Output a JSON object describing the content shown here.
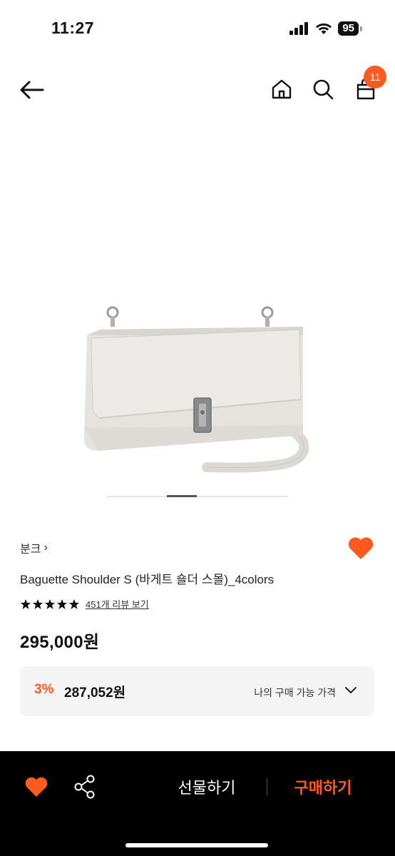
{
  "status_bar": {
    "time": "11:27",
    "battery": "95"
  },
  "header": {
    "cart_count": "11"
  },
  "product": {
    "brand": "분크",
    "brand_chevron": "›",
    "name": "Baguette Shoulder S (바게트 숄더 스몰)_4colors",
    "rating_stars": 5,
    "review_link": "451개 리뷰 보기",
    "price": "295,000원",
    "image_pages": {
      "current": 2,
      "total": 6
    }
  },
  "my_price": {
    "discount_rate": "3%",
    "discounted_price": "287,052원",
    "label": "나의 구매 가능 가격"
  },
  "bottom_bar": {
    "gift_label": "선물하기",
    "buy_label": "구매하기"
  },
  "colors": {
    "accent": "#ff5a1f",
    "bottom_bar": "#000000",
    "price_box": "#f4f4f5"
  },
  "icons": [
    "back-arrow-icon",
    "home-icon",
    "search-icon",
    "shopping-bag-icon",
    "heart-icon",
    "star-icon",
    "chevron-down-icon",
    "share-icon"
  ]
}
